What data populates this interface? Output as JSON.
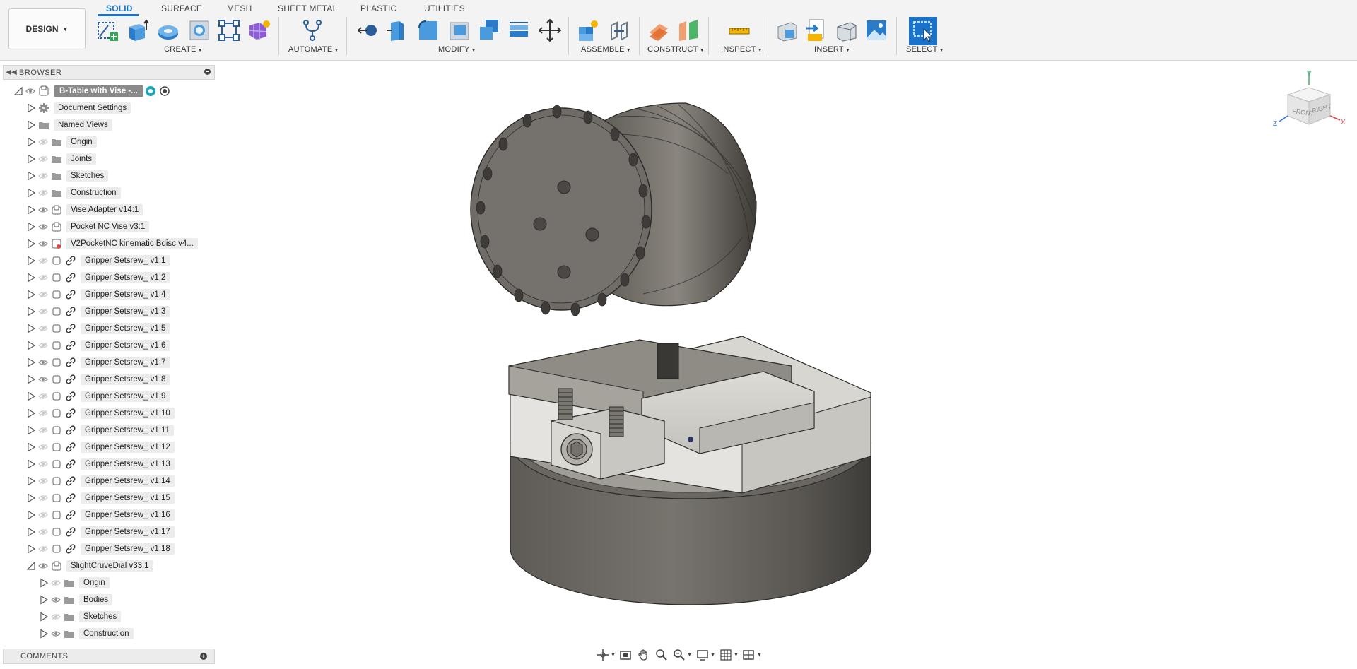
{
  "app": {
    "workspace_button": "DESIGN",
    "tabs": [
      {
        "label": "SOLID",
        "active": true
      },
      {
        "label": "SURFACE",
        "active": false
      },
      {
        "label": "MESH",
        "active": false
      },
      {
        "label": "SHEET METAL",
        "active": false
      },
      {
        "label": "PLASTIC",
        "active": false
      },
      {
        "label": "UTILITIES",
        "active": false
      }
    ],
    "groups": {
      "create": "CREATE",
      "automate": "AUTOMATE",
      "modify": "MODIFY",
      "assemble": "ASSEMBLE",
      "construct": "CONSTRUCT",
      "inspect": "INSPECT",
      "insert": "INSERT",
      "select": "SELECT"
    },
    "accent_color": "#1a73c8"
  },
  "browser": {
    "title": "BROWSER",
    "root": "B-Table with Vise -...",
    "items": [
      {
        "label": "Document Settings",
        "icon": "gear-icon"
      },
      {
        "label": "Named Views",
        "icon": "folder-icon"
      },
      {
        "label": "Origin",
        "icon": "folder-icon"
      },
      {
        "label": "Joints",
        "icon": "folder-icon"
      },
      {
        "label": "Sketches",
        "icon": "folder-icon"
      },
      {
        "label": "Construction",
        "icon": "folder-icon"
      },
      {
        "label": "Vise Adapter v14:1",
        "icon": "component-icon"
      },
      {
        "label": "Pocket NC Vise v3:1",
        "icon": "component-icon"
      },
      {
        "label": "V2PocketNC kinematic Bdisc v4...",
        "icon": "component-error-icon"
      },
      {
        "label": "Gripper Setsrew_ v1:1",
        "icon": "link-icon"
      },
      {
        "label": "Gripper Setsrew_ v1:2",
        "icon": "link-icon"
      },
      {
        "label": "Gripper Setsrew_ v1:4",
        "icon": "link-icon"
      },
      {
        "label": "Gripper Setsrew_ v1:3",
        "icon": "link-icon"
      },
      {
        "label": "Gripper Setsrew_ v1:5",
        "icon": "link-icon"
      },
      {
        "label": "Gripper Setsrew_ v1:6",
        "icon": "link-icon"
      },
      {
        "label": "Gripper Setsrew_ v1:7",
        "icon": "link-icon"
      },
      {
        "label": "Gripper Setsrew_ v1:8",
        "icon": "link-icon"
      },
      {
        "label": "Gripper Setsrew_ v1:9",
        "icon": "link-icon"
      },
      {
        "label": "Gripper Setsrew_ v1:10",
        "icon": "link-icon"
      },
      {
        "label": "Gripper Setsrew_ v1:11",
        "icon": "link-icon"
      },
      {
        "label": "Gripper Setsrew_ v1:12",
        "icon": "link-icon"
      },
      {
        "label": "Gripper Setsrew_ v1:13",
        "icon": "link-icon"
      },
      {
        "label": "Gripper Setsrew_ v1:14",
        "icon": "link-icon"
      },
      {
        "label": "Gripper Setsrew_ v1:15",
        "icon": "link-icon"
      },
      {
        "label": "Gripper Setsrew_ v1:16",
        "icon": "link-icon"
      },
      {
        "label": "Gripper Setsrew_ v1:17",
        "icon": "link-icon"
      },
      {
        "label": "Gripper Setsrew_ v1:18",
        "icon": "link-icon"
      },
      {
        "label": "SlightCruveDial v33:1",
        "icon": "component-icon"
      },
      {
        "label": "Origin",
        "icon": "folder-icon"
      },
      {
        "label": "Bodies",
        "icon": "folder-icon"
      },
      {
        "label": "Sketches",
        "icon": "folder-icon"
      },
      {
        "label": "Construction",
        "icon": "folder-icon"
      }
    ]
  },
  "comments": {
    "title": "COMMENTS"
  },
  "viewcube": {
    "front": "FRONT",
    "right": "RIGHT",
    "x": "X",
    "y": "Y",
    "z": "Z"
  }
}
